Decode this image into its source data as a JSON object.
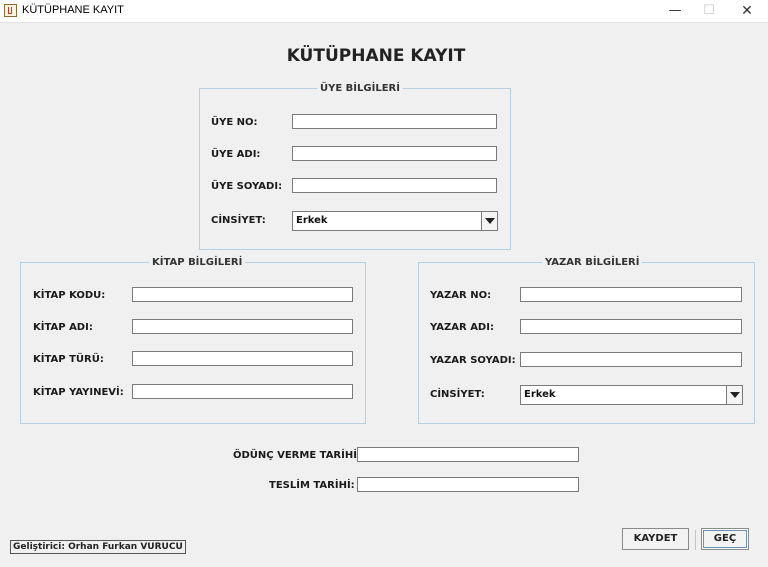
{
  "window": {
    "title": "KÜTÜPHANE KAYIT",
    "minimize_glyph": "—",
    "maximize_glyph": "☐",
    "close_glyph": "✕"
  },
  "heading": "KÜTÜPHANE KAYIT",
  "uye": {
    "legend": "ÜYE BİLGİLERİ",
    "no_label": "ÜYE NO:",
    "no_value": "",
    "adi_label": "ÜYE ADI:",
    "adi_value": "",
    "soyadi_label": "ÜYE SOYADI:",
    "soyadi_value": "",
    "cinsiyet_label": "CİNSİYET:",
    "cinsiyet_value": "Erkek"
  },
  "kitap": {
    "legend": "KİTAP BİLGİLERİ",
    "kodu_label": "KİTAP KODU:",
    "kodu_value": "",
    "adi_label": "KİTAP ADI:",
    "adi_value": "",
    "turu_label": "KİTAP TÜRÜ:",
    "turu_value": "",
    "yayinevi_label": "KİTAP YAYINEVİ:",
    "yayinevi_value": ""
  },
  "yazar": {
    "legend": "YAZAR BİLGİLERİ",
    "no_label": "YAZAR NO:",
    "no_value": "",
    "adi_label": "YAZAR ADI:",
    "adi_value": "",
    "soyadi_label": "YAZAR SOYADI:",
    "soyadi_value": "",
    "cinsiyet_label": "CİNSİYET:",
    "cinsiyet_value": "Erkek"
  },
  "odunc": {
    "verme_label": "ÖDÜNÇ VERME TARİHİ:",
    "verme_value": "",
    "teslim_label": "TESLİM TARİHİ:",
    "teslim_value": ""
  },
  "buttons": {
    "kaydet": "KAYDET",
    "gec": "GEÇ"
  },
  "credit": "Geliştirici: Orhan Furkan VURUCU",
  "colors": {
    "background": "#f0f0f0",
    "panel_border": "#b8cfe0",
    "field_border": "#7a7a7a"
  }
}
